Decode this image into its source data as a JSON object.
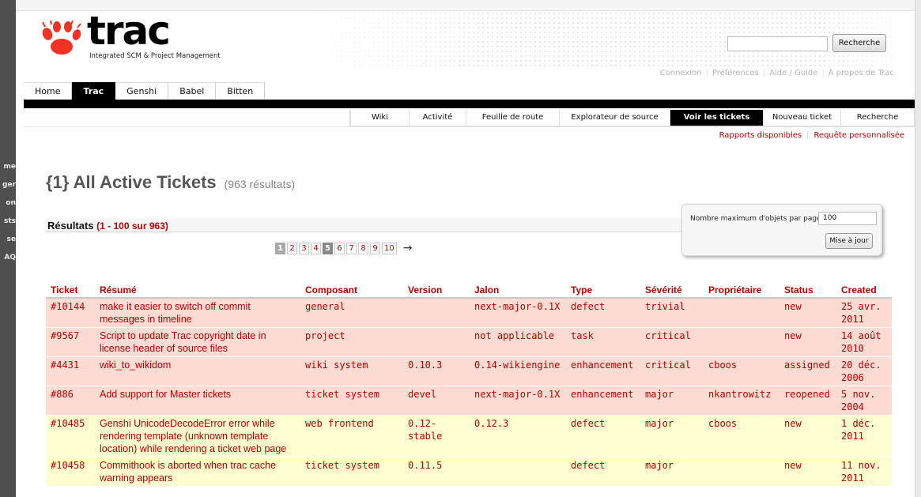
{
  "left_strip": [
    "me",
    "ger",
    "on",
    "sts",
    "se",
    "AQ"
  ],
  "header": {
    "logo_word": "trac",
    "tagline": "Integrated SCM & Project Management",
    "search_button": "Recherche",
    "metanav": [
      "Connexion",
      "Préférences",
      "Aide / Guide",
      "À propos de Trac"
    ]
  },
  "project_tabs": [
    "Home",
    "Trac",
    "Genshi",
    "Babel",
    "Bitten"
  ],
  "mainnav": [
    "Wiki",
    "Activité",
    "Feuille de route",
    "Explorateur de source",
    "Voir les tickets",
    "Nouveau ticket",
    "Recherche"
  ],
  "ctxnav": [
    "Rapports disponibles",
    "Requête personnalisée"
  ],
  "report": {
    "title": "{1} All Active Tickets",
    "count": "(963 résultats)",
    "results_label": "Résultats",
    "results_range": "(1 - 100 sur 963)"
  },
  "pager": {
    "pages": [
      "1",
      "2",
      "3",
      "4",
      "5",
      "6",
      "7",
      "8",
      "9",
      "10"
    ],
    "current": "1",
    "next": "→"
  },
  "prefs": {
    "label": "Nombre maximum d'objets par page",
    "value": "100",
    "button": "Mise à jour"
  },
  "table": {
    "headers": [
      "Ticket",
      "Résumé",
      "Composant",
      "Version",
      "Jalon",
      "Type",
      "Sévérité",
      "Propriétaire",
      "Status",
      "Created"
    ],
    "rows": [
      {
        "ticket": "#10144",
        "summary": "make it easier to switch off commit messages in timeline",
        "component": "general",
        "version": "",
        "milestone": "next-major-0.1X",
        "type": "defect",
        "severity": "trivial",
        "owner": "",
        "status": "new",
        "created": "25 avr. 2011"
      },
      {
        "ticket": "#9567",
        "summary": "Script to update Trac copyright date in license header of source files",
        "component": "project",
        "version": "",
        "milestone": "not applicable",
        "type": "task",
        "severity": "critical",
        "owner": "",
        "status": "new",
        "created": "14 août 2010"
      },
      {
        "ticket": "#4431",
        "summary": "wiki_to_wikidom",
        "component": "wiki system",
        "version": "0.10.3",
        "milestone": "0.14-wikiengine",
        "type": "enhancement",
        "severity": "critical",
        "owner": "cboos",
        "status": "assigned",
        "created": "20 déc. 2006"
      },
      {
        "ticket": "#886",
        "summary": "Add support for Master tickets",
        "component": "ticket system",
        "version": "devel",
        "milestone": "next-major-0.1X",
        "type": "enhancement",
        "severity": "major",
        "owner": "nkantrowitz",
        "status": "reopened",
        "created": "5 nov. 2004"
      },
      {
        "ticket": "#10485",
        "summary": "Genshi UnicodeDecodeError error while rendering template (unknown template location) while rendering a ticket web page",
        "component": "web frontend",
        "version": "0.12-stable",
        "milestone": "0.12.3",
        "type": "defect",
        "severity": "major",
        "owner": "cboos",
        "status": "new",
        "created": "1 déc. 2011"
      },
      {
        "ticket": "#10458",
        "summary": "Commithook is aborted when trac cache warning appears",
        "component": "ticket system",
        "version": "0.11.5",
        "milestone": "",
        "type": "defect",
        "severity": "major",
        "owner": "",
        "status": "new",
        "created": "11 nov. 2011"
      }
    ]
  },
  "colors": {
    "link": "#bb0000",
    "critical_row": "#fedcd4",
    "major_row": "#fefed0",
    "logo_paw": "#ee3322"
  }
}
